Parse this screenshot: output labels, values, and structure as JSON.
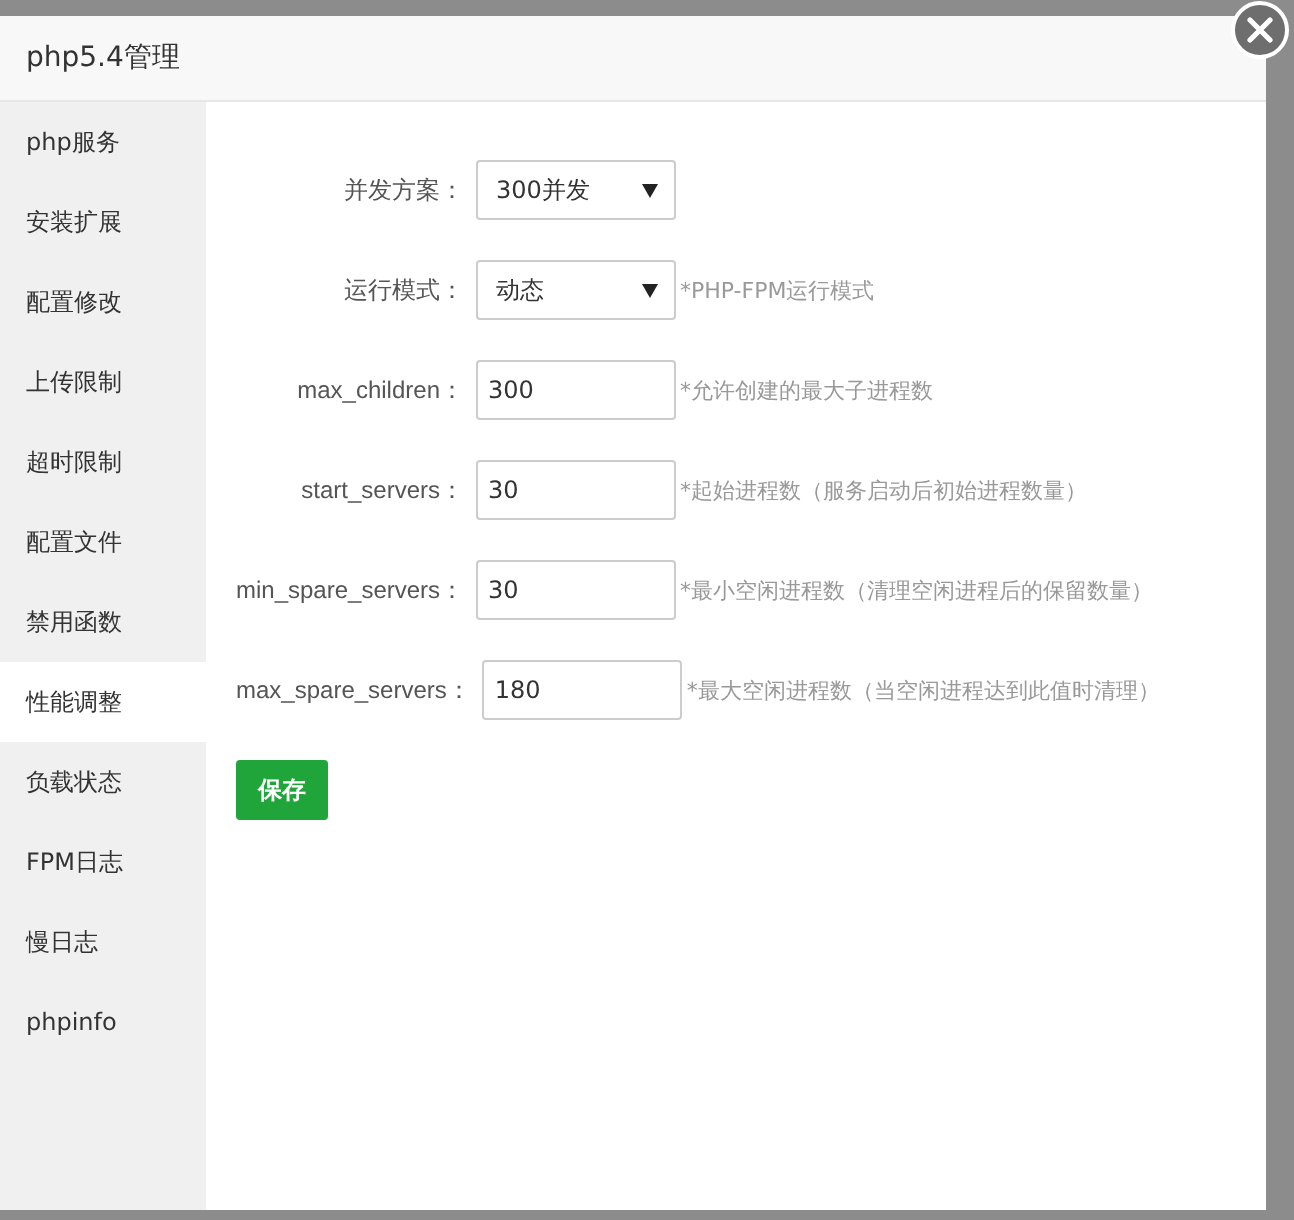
{
  "window": {
    "title": "php5.4管理"
  },
  "sidebar": {
    "items": [
      {
        "label": "php服务",
        "selected": false
      },
      {
        "label": "安装扩展",
        "selected": false
      },
      {
        "label": "配置修改",
        "selected": false
      },
      {
        "label": "上传限制",
        "selected": false
      },
      {
        "label": "超时限制",
        "selected": false
      },
      {
        "label": "配置文件",
        "selected": false
      },
      {
        "label": "禁用函数",
        "selected": false
      },
      {
        "label": "性能调整",
        "selected": true
      },
      {
        "label": "负载状态",
        "selected": false
      },
      {
        "label": "FPM日志",
        "selected": false
      },
      {
        "label": "慢日志",
        "selected": false
      },
      {
        "label": "phpinfo",
        "selected": false
      }
    ]
  },
  "form": {
    "fields": [
      {
        "kind": "select",
        "label": "并发方案：",
        "value": "300并发"
      },
      {
        "kind": "select",
        "label": "运行模式：",
        "value": "动态",
        "hint": "*PHP-FPM运行模式"
      },
      {
        "kind": "input",
        "label": "max_children：",
        "value": "300",
        "hint": "*允许创建的最大子进程数"
      },
      {
        "kind": "input",
        "label": "start_servers：",
        "value": "30",
        "hint": "*起始进程数（服务启动后初始进程数量）"
      },
      {
        "kind": "input",
        "label": "min_spare_servers：",
        "value": "30",
        "hint": "*最小空闲进程数（清理空闲进程后的保留数量）"
      },
      {
        "kind": "input",
        "label": "max_spare_servers：",
        "value": "180",
        "hint": "*最大空闲进程数（当空闲进程达到此值时清理）"
      }
    ],
    "save_button": "保存"
  }
}
